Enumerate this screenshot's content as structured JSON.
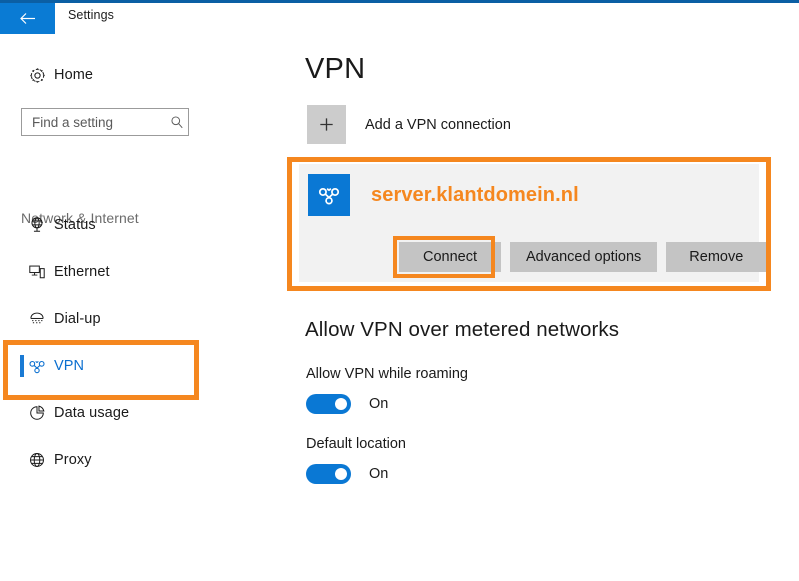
{
  "window": {
    "title": "Settings",
    "back_icon": "back-arrow-icon"
  },
  "sidebar": {
    "home": {
      "label": "Home",
      "icon": "gear-icon"
    },
    "search": {
      "placeholder": "Find a setting",
      "value": "",
      "icon": "search-icon"
    },
    "section_header": "Network & Internet",
    "items": [
      {
        "label": "Status",
        "icon": "globe-status-icon",
        "selected": false
      },
      {
        "label": "Ethernet",
        "icon": "ethernet-icon",
        "selected": false
      },
      {
        "label": "Dial-up",
        "icon": "dialup-modem-icon",
        "selected": false
      },
      {
        "label": "VPN",
        "icon": "vpn-icon",
        "selected": true
      },
      {
        "label": "Data usage",
        "icon": "pie-chart-icon",
        "selected": false
      },
      {
        "label": "Proxy",
        "icon": "globe-icon",
        "selected": false
      }
    ]
  },
  "main": {
    "page_title": "VPN",
    "add_connection": {
      "label": "Add a VPN connection",
      "icon": "plus-icon"
    },
    "connection": {
      "name": "server.klantdomein.nl",
      "icon": "vpn-connection-icon",
      "buttons": {
        "connect": "Connect",
        "advanced": "Advanced options",
        "remove": "Remove"
      }
    },
    "metered": {
      "heading": "Allow VPN over metered networks",
      "settings": [
        {
          "label": "Allow VPN while roaming",
          "state": "On"
        },
        {
          "label": "Default location",
          "state": "On"
        }
      ]
    }
  },
  "colors": {
    "accent_blue": "#0a78d4",
    "annotation_orange": "#f5871f",
    "card_gray": "#f2f2f2",
    "button_gray": "#c4c4c4"
  }
}
